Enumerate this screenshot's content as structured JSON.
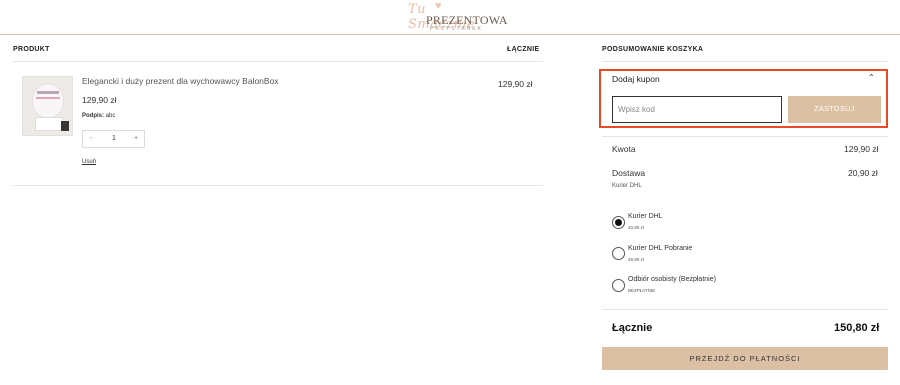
{
  "brand": {
    "logo_script": "Tu Smacznie",
    "logo_main": "PREZENTOWA",
    "logo_sub": "PRZYSTANEK"
  },
  "cart": {
    "col_product": "PRODUKT",
    "col_total": "ŁĄCZNIE",
    "item": {
      "name": "Elegancki i duży prezent dla wychowawcy BalonBox",
      "price": "129,90 zł",
      "signature_label": "Podpis:",
      "signature_value": "abc",
      "qty_minus": "-",
      "quantity": "1",
      "qty_plus": "+",
      "remove_label": "Usuń",
      "line_total": "129,90 zł"
    }
  },
  "summary": {
    "heading": "PODSUMOWANIE KOSZYKA",
    "coupon": {
      "label": "Dodaj kupon",
      "chevron": "⌃",
      "placeholder": "Wpisz kod",
      "apply_label": "ZASTOSUJ"
    },
    "amount_label": "Kwota",
    "amount_value": "129,90 zł",
    "shipping_label": "Dostawa",
    "shipping_value": "20,90 zł",
    "shipping_method": "Kurier DHL",
    "shipping_options": [
      {
        "label": "Kurier DHL",
        "price": "20,90 zł",
        "selected": true
      },
      {
        "label": "Kurier DHL Pobranie",
        "price": "29,90 zł",
        "selected": false
      },
      {
        "label": "Odbiór osobisty (Bezpłatnie)",
        "price": "BEZPŁATNIE",
        "selected": false
      }
    ],
    "total_label": "Łącznie",
    "total_value": "150,80 zł",
    "checkout_label": "PRZEJDŹ DO PŁATNOŚCI"
  },
  "colors": {
    "accent": "#dcc0a4",
    "highlight": "#e84a23"
  }
}
